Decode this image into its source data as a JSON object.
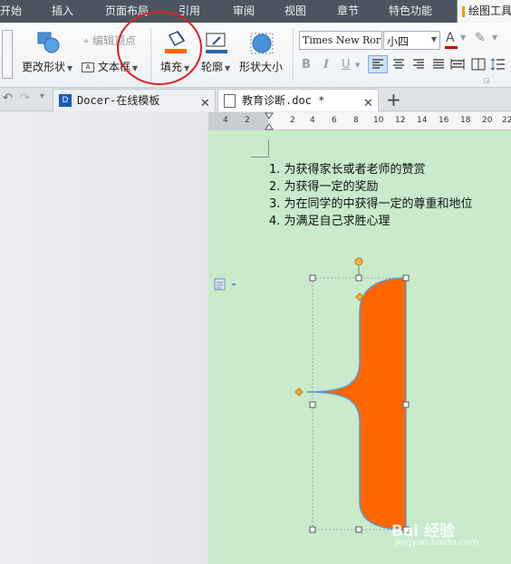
{
  "menubar": {
    "items": [
      "开始",
      "插入",
      "页面布局",
      "引用",
      "审阅",
      "视图",
      "章节",
      "特色功能",
      "绘图工具"
    ]
  },
  "ribbon": {
    "change_shape": "更改形状",
    "edit_vertex": "编辑顶点",
    "text_box": "文本框",
    "fill": "填充",
    "outline": "轮廓",
    "shape_size": "形状大小",
    "font_name": "Times New Ror",
    "font_size": "小四",
    "bold": "B",
    "italic": "I",
    "underline": "U"
  },
  "tabs": [
    {
      "title": "Docer-在线模板"
    },
    {
      "title": "教育诊断.doc *"
    }
  ],
  "ruler": {
    "ticks": [
      "4",
      "2",
      "2",
      "4",
      "6",
      "8",
      "10",
      "12",
      "14",
      "16",
      "18",
      "20",
      "22"
    ]
  },
  "document": {
    "list": [
      "1. 为获得家长或者老师的赞赏",
      "2. 为获得一定的奖励",
      "3. 为在同学的中获得一定的尊重和地位",
      "4. 为满足自己求胜心理"
    ]
  },
  "shape": {
    "fill_color": "#ff6600",
    "outline_color": "#5b9bd5"
  },
  "highlight": {
    "color": "#e02020"
  },
  "watermark": {
    "brand": "Bai 经验",
    "url": "jingyan.baidu.com"
  }
}
